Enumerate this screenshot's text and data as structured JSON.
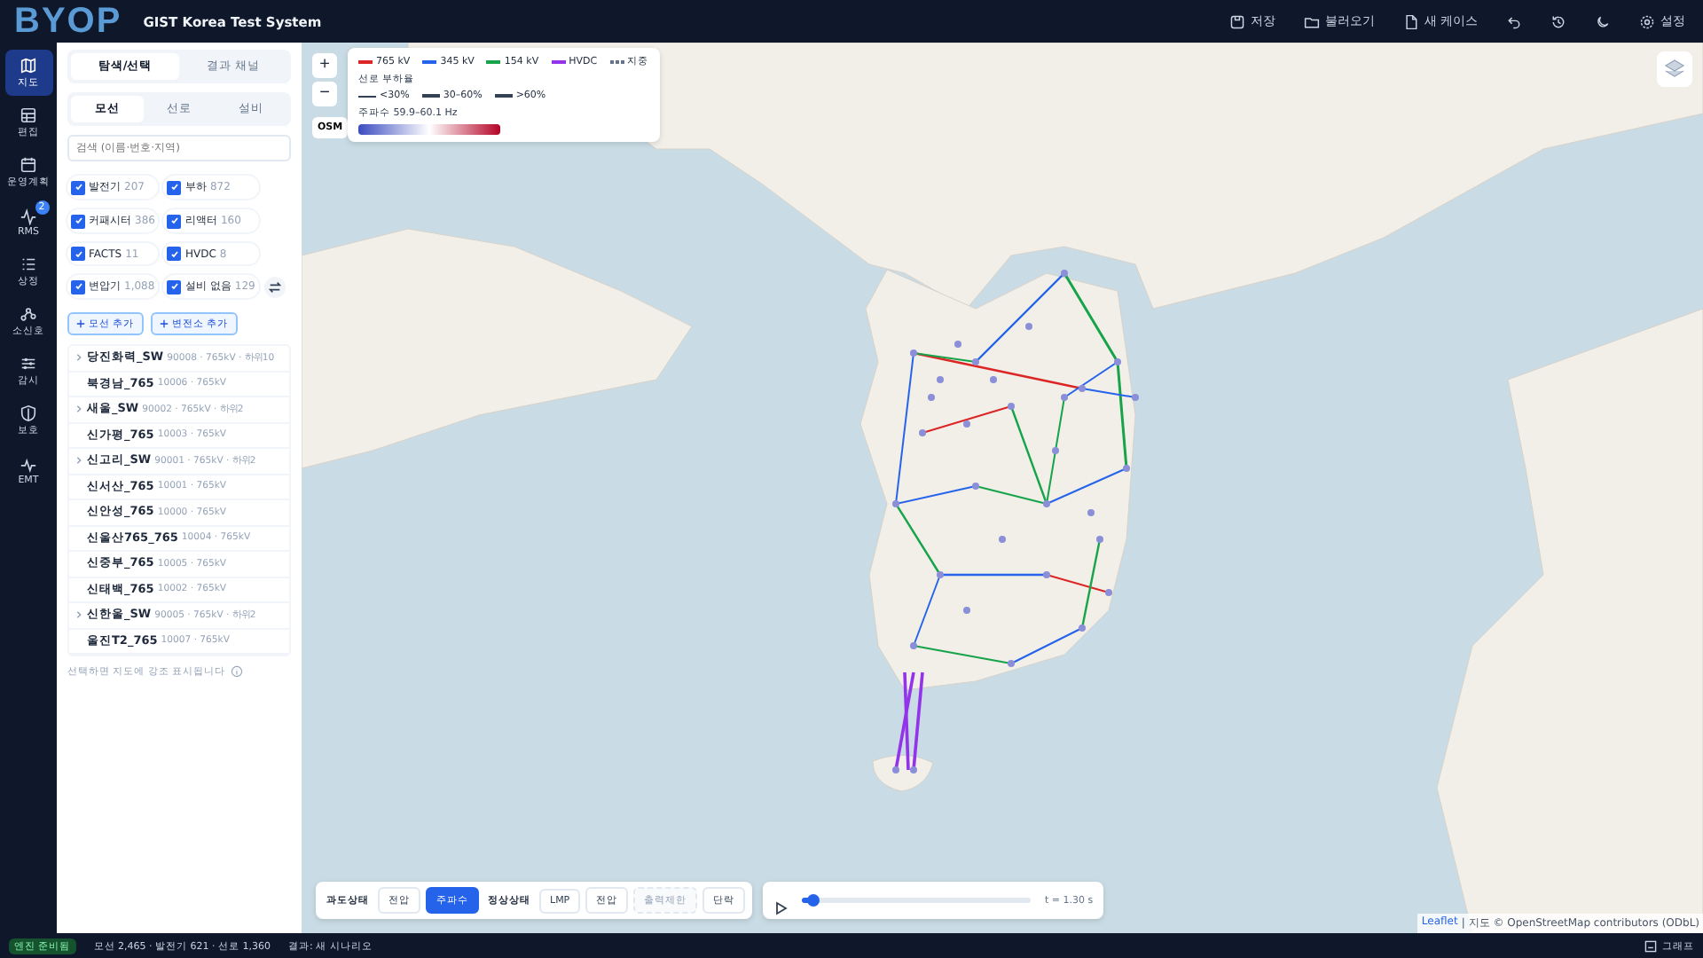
{
  "header": {
    "logo": "BYOP",
    "title": "GIST Korea Test System",
    "actions": [
      {
        "kind": "save",
        "label": "저장"
      },
      {
        "kind": "open",
        "label": "불러오기"
      },
      {
        "kind": "new",
        "label": "새 케이스"
      },
      {
        "kind": "undo"
      },
      {
        "kind": "history"
      },
      {
        "kind": "theme"
      },
      {
        "kind": "settings",
        "label": "설정"
      }
    ]
  },
  "nav": [
    {
      "label": "지도",
      "selected": true
    },
    {
      "label": "편집",
      "selected": false
    },
    {
      "label": "운영계획",
      "selected": false
    },
    {
      "label": "RMS",
      "selected": false,
      "badge": "2"
    },
    {
      "label": "상정",
      "selected": false
    },
    {
      "label": "소신호",
      "selected": false
    },
    {
      "label": "감시",
      "selected": false
    },
    {
      "label": "보호",
      "selected": false
    },
    {
      "label": "EMT",
      "selected": false
    }
  ],
  "panel": {
    "tabs": [
      {
        "label": "탐색/선택",
        "selected": true
      },
      {
        "label": "결과 채널",
        "selected": false
      }
    ],
    "subtabs": [
      {
        "label": "모선",
        "selected": true
      },
      {
        "label": "선로",
        "selected": false
      },
      {
        "label": "설비",
        "selected": false
      }
    ],
    "search": {
      "placeholder": "검색 (이름·번호·지역)"
    },
    "filters": [
      {
        "label": "발전기",
        "count": "207",
        "checked": true
      },
      {
        "label": "부하",
        "count": "872",
        "checked": true
      },
      {
        "label": "커패시터",
        "count": "386",
        "checked": true
      },
      {
        "label": "리액터",
        "count": "160",
        "checked": true
      },
      {
        "label": "FACTS",
        "count": "11",
        "checked": true
      },
      {
        "label": "HVDC",
        "count": "8",
        "checked": true
      },
      {
        "label": "변압기",
        "count": "1,088",
        "checked": true
      },
      {
        "label": "설비 없음",
        "count": "129",
        "checked": true
      }
    ],
    "add_buttons": [
      "모선 추가",
      "변전소 추가"
    ],
    "buses": [
      {
        "kind": "group",
        "name": "당진화력_SW",
        "meta": "90008 · 765kV · 하위10"
      },
      {
        "kind": "bus",
        "name": "북경남_765",
        "meta": "10006 · 765kV"
      },
      {
        "kind": "group",
        "name": "새울_SW",
        "meta": "90002 · 765kV · 하위2"
      },
      {
        "kind": "bus",
        "name": "신가평_765",
        "meta": "10003 · 765kV"
      },
      {
        "kind": "group",
        "name": "신고리_SW",
        "meta": "90001 · 765kV · 하위2"
      },
      {
        "kind": "bus",
        "name": "신서산_765",
        "meta": "10001 · 765kV"
      },
      {
        "kind": "bus",
        "name": "신안성_765",
        "meta": "10000 · 765kV"
      },
      {
        "kind": "bus",
        "name": "신울산765_765",
        "meta": "10004 · 765kV"
      },
      {
        "kind": "bus",
        "name": "신중부_765",
        "meta": "10005 · 765kV"
      },
      {
        "kind": "bus",
        "name": "신태백_765",
        "meta": "10002 · 765kV"
      },
      {
        "kind": "group",
        "name": "신한울_SW",
        "meta": "90005 · 765kV · 하위2"
      },
      {
        "kind": "bus",
        "name": "울진T2_765",
        "meta": "10007 · 765kV"
      }
    ],
    "hint": "선택하면 지도에 강조 표시됩니다"
  },
  "map": {
    "zoom_in": "+",
    "zoom_out": "−",
    "basemap": "OSM",
    "legend": {
      "voltages": [
        {
          "label": "765 kV",
          "color": "#dc2626",
          "kind": "solid"
        },
        {
          "label": "345 kV",
          "color": "#2563eb",
          "kind": "solid"
        },
        {
          "label": "154 kV",
          "color": "#16a34a",
          "kind": "solid"
        },
        {
          "label": "HVDC",
          "color": "#9333ea",
          "kind": "solid"
        },
        {
          "label": "지중",
          "color": "#64748b",
          "kind": "dotted"
        }
      ],
      "load_title": "선로 부하율",
      "loads": [
        "<30%",
        "30–60%",
        ">60%"
      ],
      "frequency": "주파수 59.9–60.1 Hz"
    },
    "attribution_link": "Leaflet",
    "attribution": "| 지도 © OpenStreetMap contributors (ODbL)"
  },
  "toolbar": [
    {
      "kind": "label",
      "label": "과도상태"
    },
    {
      "kind": "button",
      "label": "전압",
      "selected": false,
      "disabled": false
    },
    {
      "kind": "button",
      "label": "주파수",
      "selected": true,
      "disabled": false
    },
    {
      "kind": "label",
      "label": "정상상태"
    },
    {
      "kind": "button",
      "label": "LMP",
      "selected": false,
      "disabled": false
    },
    {
      "kind": "button",
      "label": "전압",
      "selected": false,
      "disabled": false
    },
    {
      "kind": "button",
      "label": "출력제한",
      "selected": false,
      "disabled": true
    },
    {
      "kind": "button",
      "label": "단락",
      "selected": false,
      "disabled": false
    }
  ],
  "player": {
    "level": 0.05,
    "time": "t = 1.30 s"
  },
  "status_bar": {
    "engine": "엔진 준비됨",
    "counts": "모선 2,465 · 발전기 621 · 선로 1,360",
    "result": "결과: 새 시나리오",
    "graph": "그래프"
  }
}
